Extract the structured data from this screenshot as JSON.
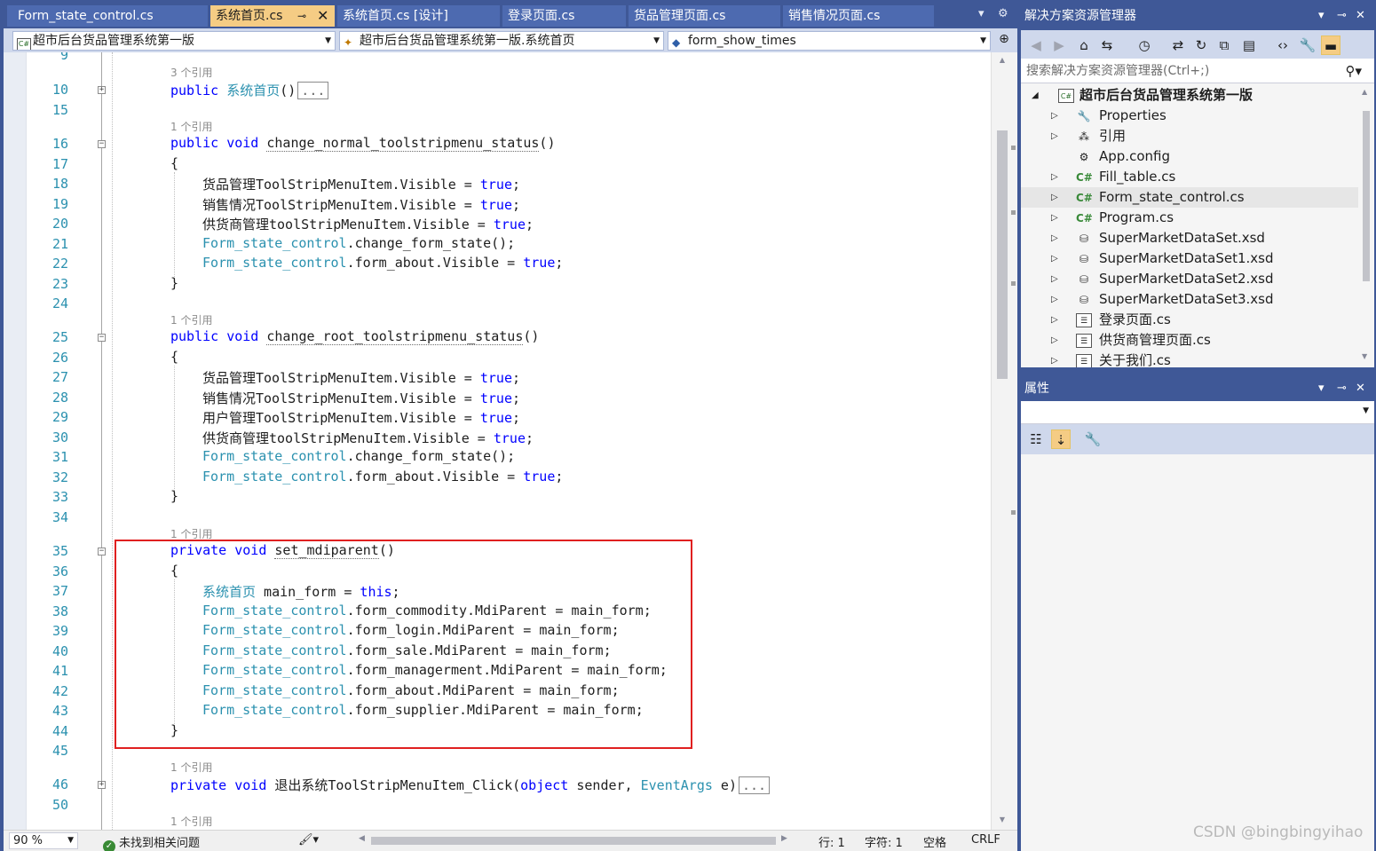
{
  "editor_tabs": [
    {
      "label": "Form_state_control.cs",
      "active": false
    },
    {
      "label": "系统首页.cs",
      "active": true
    },
    {
      "label": "系统首页.cs [设计]",
      "active": false
    },
    {
      "label": "登录页面.cs",
      "active": false
    },
    {
      "label": "货品管理页面.cs",
      "active": false
    },
    {
      "label": "销售情况页面.cs",
      "active": false
    }
  ],
  "navbar": {
    "project": "超市后台货品管理系统第一版",
    "class": "超市后台货品管理系统第一版.系统首页",
    "member": "form_show_times"
  },
  "line_numbers": [
    "9",
    "10",
    "15",
    "16",
    "17",
    "18",
    "19",
    "20",
    "21",
    "22",
    "23",
    "24",
    "25",
    "26",
    "27",
    "28",
    "29",
    "30",
    "31",
    "32",
    "33",
    "34",
    "35",
    "36",
    "37",
    "38",
    "39",
    "40",
    "41",
    "42",
    "43",
    "44",
    "45",
    "46",
    "50"
  ],
  "codelens": {
    "three_refs": "3 个引用",
    "one_ref": "1 个引用"
  },
  "code": {
    "kw_public": "public",
    "kw_void": "void",
    "kw_private": "private",
    "kw_true": "true",
    "kw_this": "this",
    "kw_object": "object",
    "type_home": "系统首页",
    "type_fsc": "Form_state_control",
    "type_eventargs": "EventArgs",
    "collapsed": "...",
    "m_normal": "change_normal_toolstripmenu_status",
    "m_root": "change_root_toolstripmenu_status",
    "m_mdi": "set_mdiparent",
    "m_exit": "退出系统ToolStripMenuItem_Click",
    "parens": "()",
    "open_brace": "{",
    "close_brace": "}",
    "semi": ";",
    "eq": " = ",
    "vis_goods": "货品管理ToolStripMenuItem.Visible",
    "vis_sales": "销售情况ToolStripMenuItem.Visible",
    "vis_supplier": "供货商管理toolStripMenuItem.Visible",
    "vis_user": "用户管理ToolStripMenuItem.Visible",
    "call_change_state": ".change_form_state();",
    "about_visible": ".form_about.Visible",
    "var_main_form": " main_form",
    "main_form": "main_form",
    "mdi_commodity": ".form_commodity.MdiParent",
    "mdi_login": ".form_login.MdiParent",
    "mdi_sale": ".form_sale.MdiParent",
    "mdi_managerment": ".form_managerment.MdiParent",
    "mdi_about": ".form_about.MdiParent",
    "mdi_supplier": ".form_supplier.MdiParent",
    "exit_params_open": "(",
    "exit_sender": " sender, ",
    "exit_e": " e)"
  },
  "statusbar": {
    "zoom": "90 %",
    "issues": "未找到相关问题",
    "line": "行: 1",
    "char": "字符: 1",
    "spaces": "空格",
    "eol": "CRLF"
  },
  "solution_explorer": {
    "title": "解决方案资源管理器",
    "search_placeholder": "搜索解决方案资源管理器(Ctrl+;)",
    "items": [
      {
        "label": "超市后台货品管理系统第一版",
        "icon": "csharp-project-icon"
      },
      {
        "label": "Properties",
        "icon": "wrench-icon"
      },
      {
        "label": "引用",
        "icon": "references-icon"
      },
      {
        "label": "App.config",
        "icon": "config-icon"
      },
      {
        "label": "Fill_table.cs",
        "icon": "csharp-file-icon"
      },
      {
        "label": "Form_state_control.cs",
        "icon": "csharp-file-icon"
      },
      {
        "label": "Program.cs",
        "icon": "csharp-file-icon"
      },
      {
        "label": "SuperMarketDataSet.xsd",
        "icon": "dataset-icon"
      },
      {
        "label": "SuperMarketDataSet1.xsd",
        "icon": "dataset-icon"
      },
      {
        "label": "SuperMarketDataSet2.xsd",
        "icon": "dataset-icon"
      },
      {
        "label": "SuperMarketDataSet3.xsd",
        "icon": "dataset-icon"
      },
      {
        "label": "登录页面.cs",
        "icon": "form-icon"
      },
      {
        "label": "供货商管理页面.cs",
        "icon": "form-icon"
      },
      {
        "label": "关于我们.cs",
        "icon": "form-icon"
      }
    ]
  },
  "properties": {
    "title": "属性"
  },
  "watermark": "CSDN @bingbingyihao",
  "colors": {
    "frame": "#3f5897",
    "active_tab": "#f5cc84",
    "keyword": "#0000ff",
    "type": "#2b91af",
    "highlight_box": "#e02020"
  }
}
